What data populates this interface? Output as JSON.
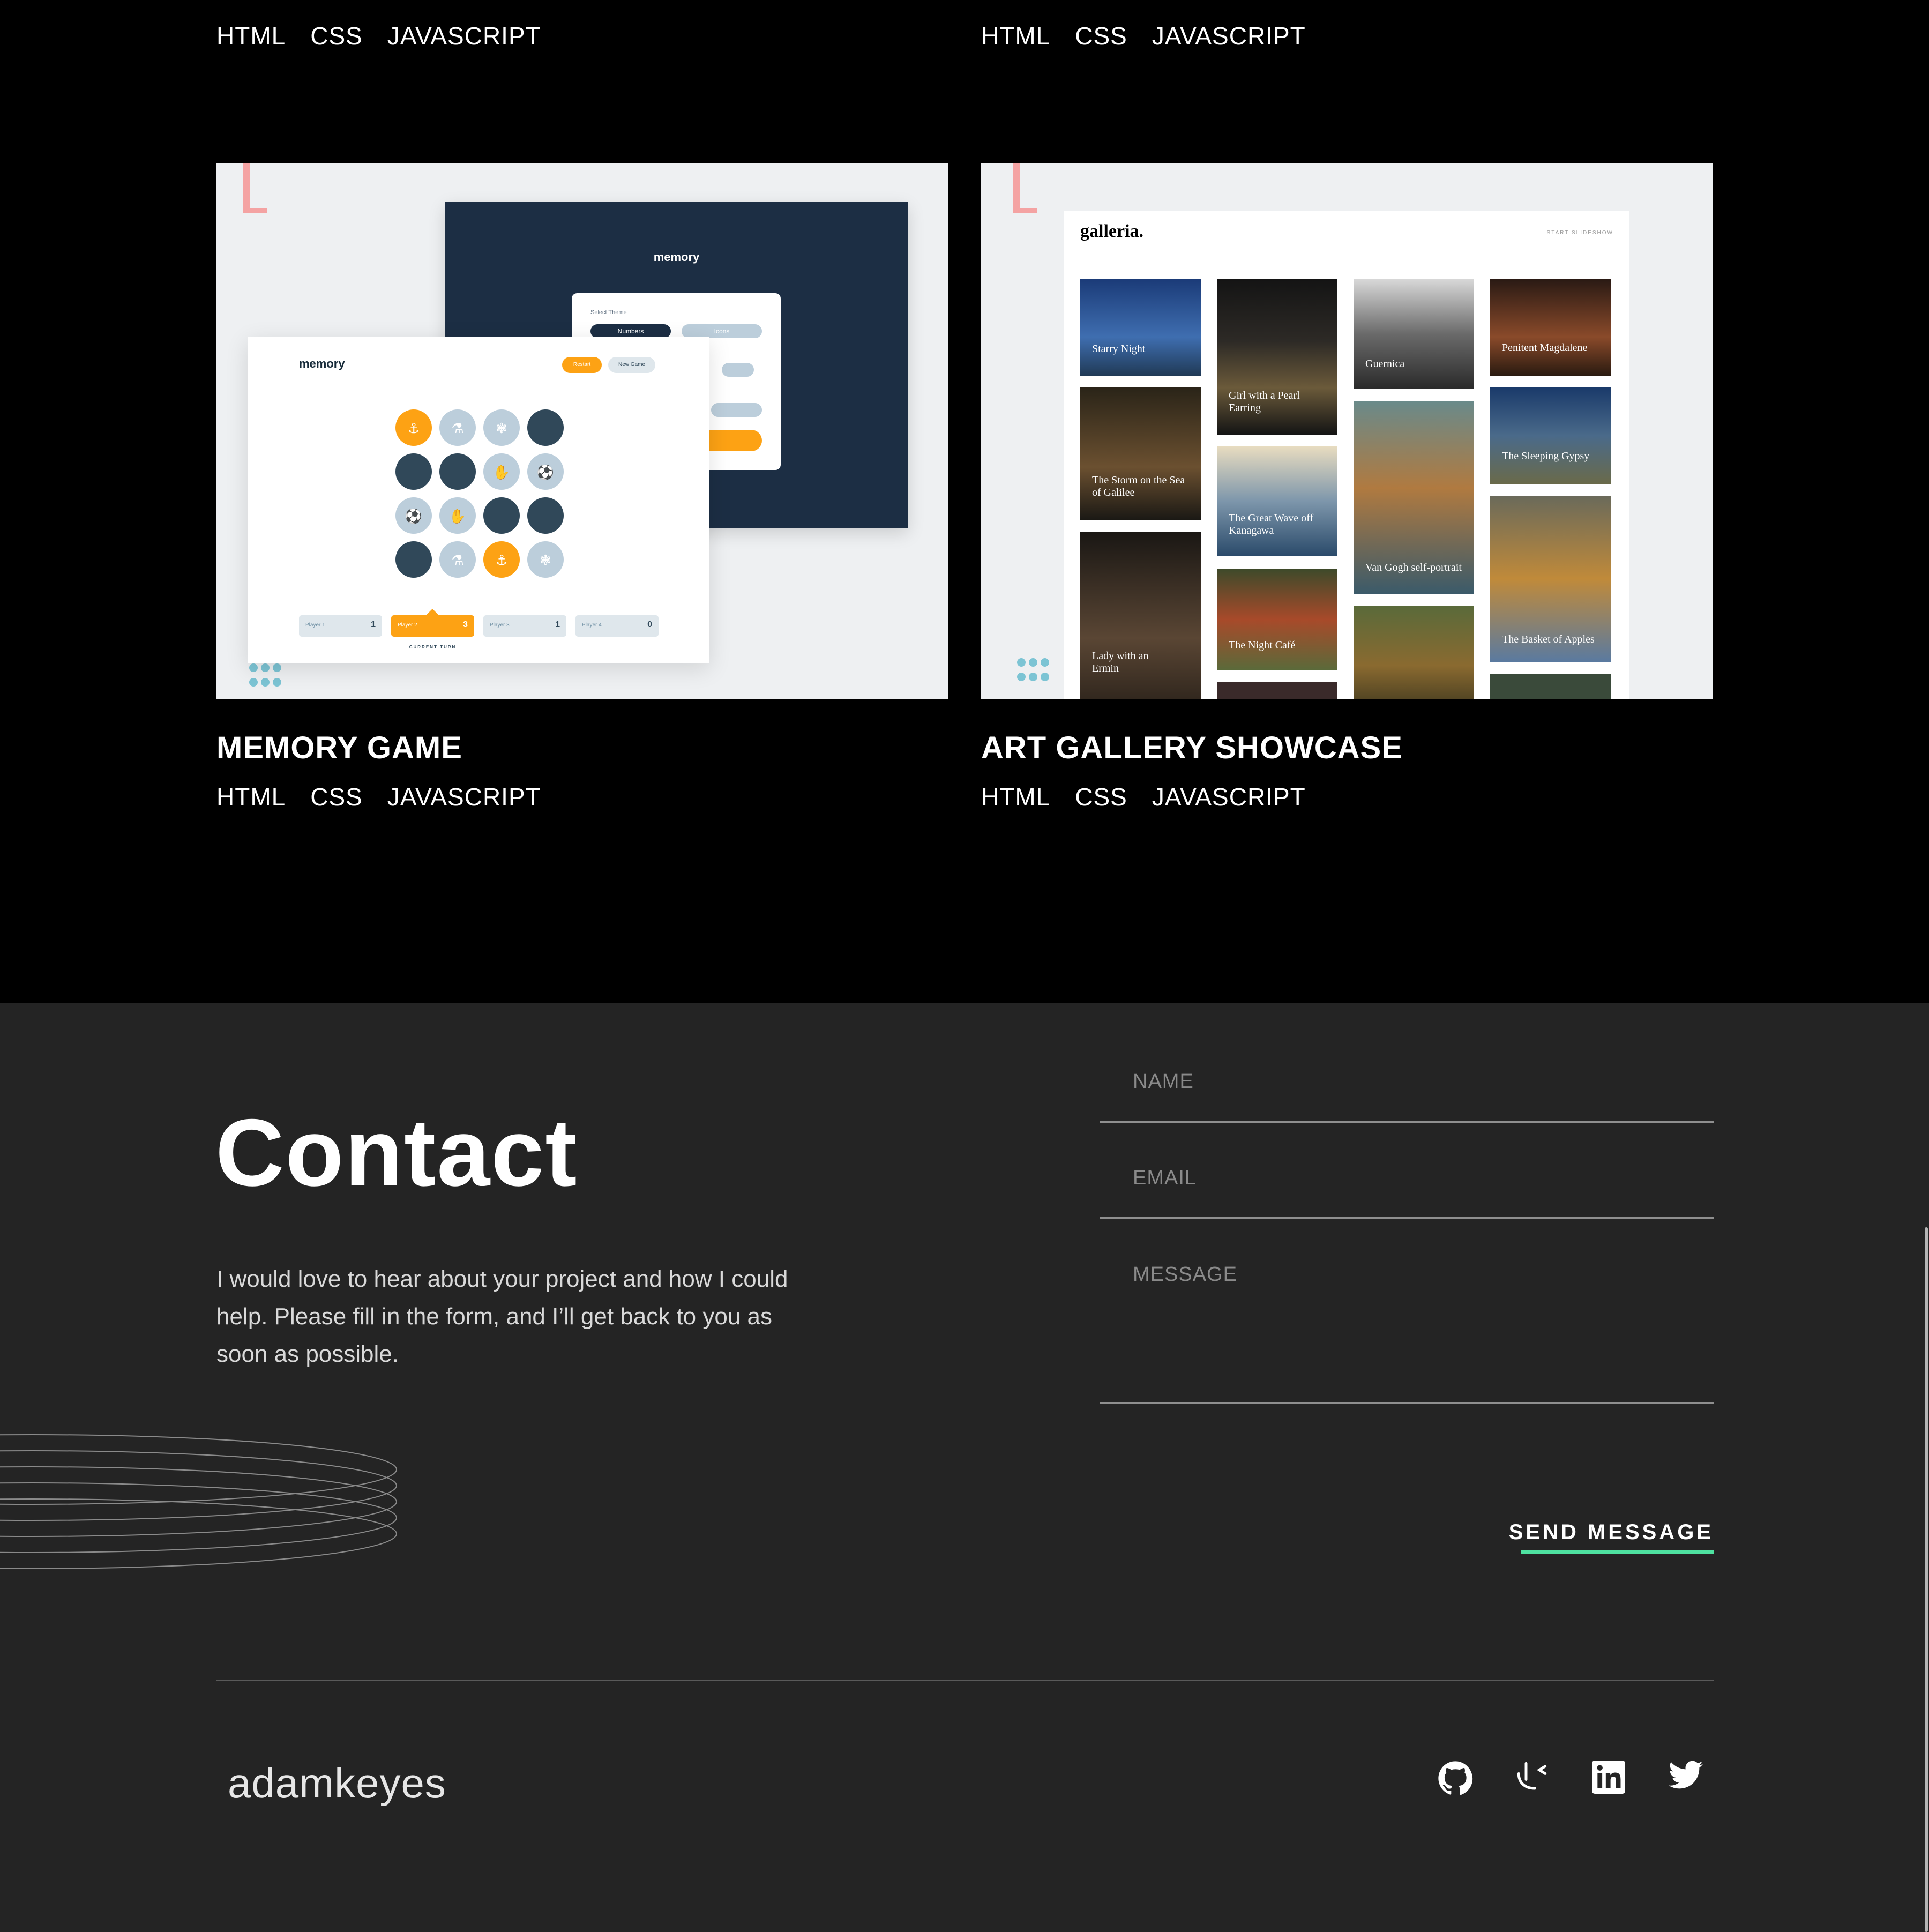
{
  "projects": [
    {
      "title": "",
      "tags": [
        "HTML",
        "CSS",
        "JAVASCRIPT"
      ]
    },
    {
      "title": "",
      "tags": [
        "HTML",
        "CSS",
        "JAVASCRIPT"
      ]
    },
    {
      "title": "MEMORY GAME",
      "tags": [
        "HTML",
        "CSS",
        "JAVASCRIPT"
      ],
      "preview": {
        "brand": "memory",
        "select_theme": "Select Theme",
        "numbers": "Numbers",
        "icons": "Icons",
        "restart": "Restart",
        "new_game": "New Game",
        "players": [
          {
            "name": "Player 1",
            "score": "1"
          },
          {
            "name": "Player 2",
            "score": "3"
          },
          {
            "name": "Player 3",
            "score": "1"
          },
          {
            "name": "Player 4",
            "score": "0"
          }
        ],
        "current_turn": "CURRENT TURN"
      }
    },
    {
      "title": "ART GALLERY SHOWCASE",
      "tags": [
        "HTML",
        "CSS",
        "JAVASCRIPT"
      ],
      "preview": {
        "brand": "galleria.",
        "slideshow": "START SLIDESHOW",
        "paintings": [
          "Starry Night",
          "Girl with a Pearl Earring",
          "Guernica",
          "Penitent Magdalene",
          "The Storm on the Sea of Galilee",
          "The Great Wave off Kanagawa",
          "Van Gogh self-portrait",
          "The Sleeping Gypsy",
          "Lady with an Ermin",
          "The Night Café",
          "The Basket of Apples"
        ]
      }
    }
  ],
  "contact": {
    "heading": "Contact",
    "text": "I would love to hear about your project and how I could help. Please fill in the form, and I’ll get back to you as soon as possible.",
    "name_placeholder": "NAME",
    "email_placeholder": "EMAIL",
    "message_placeholder": "MESSAGE",
    "send_label": "SEND MESSAGE",
    "accent": "#4ee1a0"
  },
  "footer": {
    "logo": "adamkeyes",
    "social": [
      "github-icon",
      "frontend-mentor-icon",
      "linkedin-icon",
      "twitter-icon"
    ]
  }
}
